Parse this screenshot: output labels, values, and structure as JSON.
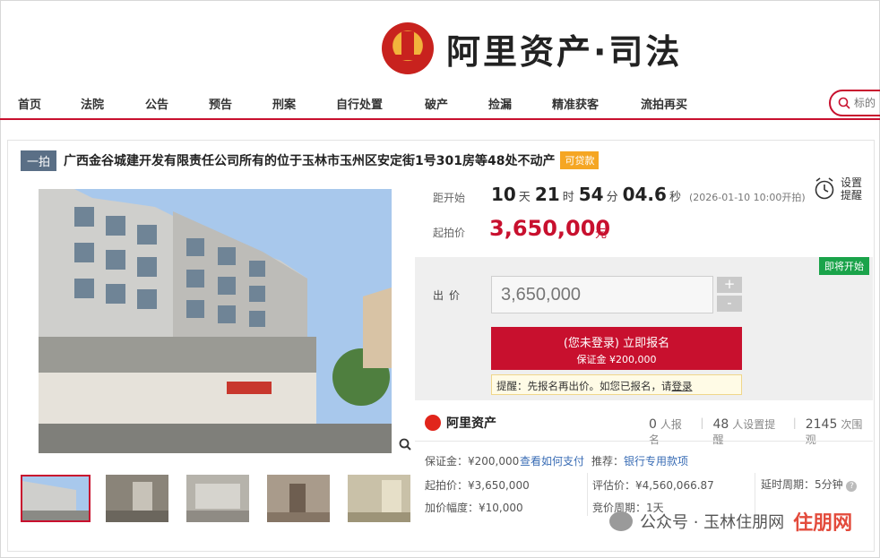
{
  "header": {
    "brand_title": "阿里资产·司法"
  },
  "nav": {
    "items": [
      {
        "label": "首页"
      },
      {
        "label": "法院"
      },
      {
        "label": "公告"
      },
      {
        "label": "预告"
      },
      {
        "label": "刑案"
      },
      {
        "label": "自行处置"
      },
      {
        "label": "破产"
      },
      {
        "label": "捡漏"
      },
      {
        "label": "精准获客"
      },
      {
        "label": "流拍再买"
      }
    ],
    "search_placeholder": "标的"
  },
  "item": {
    "round_tag": "一拍",
    "title": "广西金谷城建开发有限责任公司所有的位于玉林市玉州区安定街1号301房等48处不动产",
    "loan_badge": "可贷款"
  },
  "countdown": {
    "label": "距开始",
    "days": "10",
    "days_unit": "天",
    "hours": "21",
    "hours_unit": "时",
    "minutes": "54",
    "minutes_unit": "分",
    "seconds": "04.6",
    "seconds_unit": "秒",
    "start_time": "(2026-01-10 10:00开拍)",
    "remind_label": "设置提醒"
  },
  "price": {
    "label": "起拍价",
    "value": "3,650,000",
    "unit": "元"
  },
  "bid": {
    "status_badge": "即将开始",
    "label": "出价",
    "input_value": "3,650,000",
    "plus": "+",
    "minus": "-",
    "signup_main": "(您未登录) 立即报名",
    "signup_sub": "保证金 ¥200,000",
    "tip_prefix": "提醒：先报名再出价。如您已报名，请",
    "tip_link": "登录"
  },
  "stats": {
    "brand": "阿里资产",
    "signups_num": "0",
    "signups_label": "人报名",
    "reminders_num": "48",
    "reminders_label": "人设置提醒",
    "views_num": "2145",
    "views_label": "次围观"
  },
  "details": {
    "deposit_label": "保证金：¥200,000",
    "how_to_pay": "查看如何支付",
    "recommend_label": "推荐：",
    "bank_link": "银行专用款项",
    "start_price": "起拍价：¥3,650,000",
    "appraisal": "评估价：¥4,560,066.87",
    "delay": "延时周期：5分钟",
    "increment": "加价幅度：¥10,000",
    "cycle": "竞价周期：1天"
  },
  "watermark": {
    "text": "公众号 · 玉林住朋网",
    "logo": "住朋网"
  }
}
